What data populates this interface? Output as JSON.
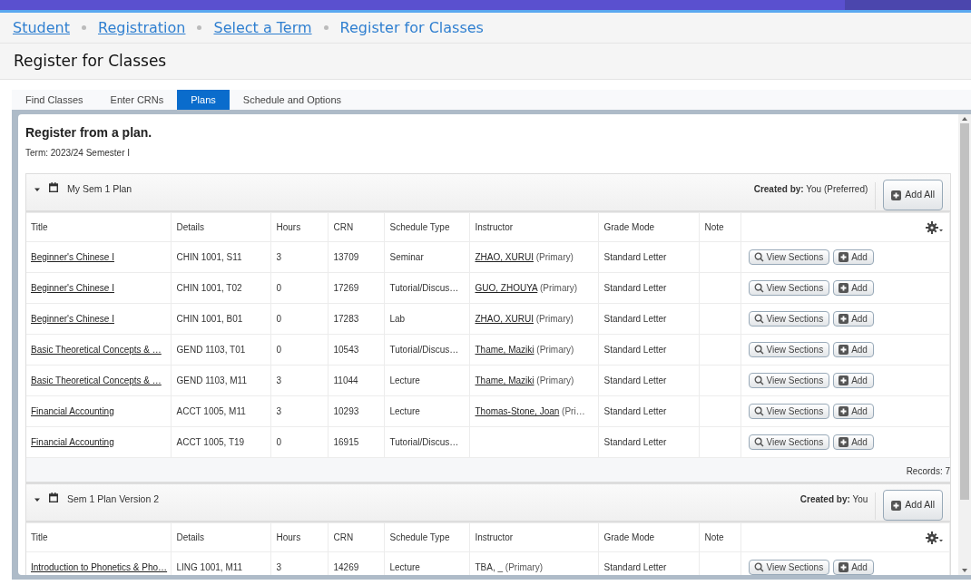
{
  "breadcrumbs": [
    {
      "label": "Student",
      "current": false
    },
    {
      "label": "Registration",
      "current": false
    },
    {
      "label": "Select a Term",
      "current": false
    },
    {
      "label": "Register for Classes",
      "current": true
    }
  ],
  "page_title": "Register for Classes",
  "tabs": [
    {
      "label": "Find Classes",
      "selected": false
    },
    {
      "label": "Enter CRNs",
      "selected": false
    },
    {
      "label": "Plans",
      "selected": true
    },
    {
      "label": "Schedule and Options",
      "selected": false
    }
  ],
  "panel": {
    "heading": "Register from a plan.",
    "term": "Term: 2023/24 Semester I"
  },
  "plans": [
    {
      "name": "My Sem 1 Plan",
      "expanded": true,
      "created_by": "**Created by:** You (Preferred)",
      "add_all": "Add All",
      "records": "Records: 7",
      "columns": [
        "Title",
        "Details",
        "Hours",
        "CRN",
        "Schedule Type",
        "Instructor",
        "Grade Mode",
        "Note"
      ],
      "rows": [
        {
          "title": "Beginner's Chinese I",
          "details": "CHIN 1001, S11",
          "hours": "3",
          "crn": "13709",
          "schedule_type": "Seminar",
          "instructor": {
            "name": "ZHAO, XURUI",
            "link": true,
            "role": "(Primary)"
          },
          "grade_mode": "Standard Letter",
          "view": "View Sections",
          "add": "Add"
        },
        {
          "title": "Beginner's Chinese I",
          "details": "CHIN 1001, T02",
          "hours": "0",
          "crn": "17269",
          "schedule_type": "Tutorial/Discus…",
          "instructor": {
            "name": "GUO, ZHOUYA",
            "link": true,
            "role": "(Primary)"
          },
          "grade_mode": "Standard Letter",
          "view": "View Sections",
          "add": "Add"
        },
        {
          "title": "Beginner's Chinese I",
          "details": "CHIN 1001, B01",
          "hours": "0",
          "crn": "17283",
          "schedule_type": "Lab",
          "instructor": {
            "name": "ZHAO, XURUI",
            "link": true,
            "role": "(Primary)"
          },
          "grade_mode": "Standard Letter",
          "view": "View Sections",
          "add": "Add"
        },
        {
          "title": "Basic Theoretical Concepts & …",
          "details": "GEND 1103, T01",
          "hours": "0",
          "crn": "10543",
          "schedule_type": "Tutorial/Discus…",
          "instructor": {
            "name": "Thame, Maziki",
            "link": true,
            "role": "(Primary)"
          },
          "grade_mode": "Standard Letter",
          "view": "View Sections",
          "add": "Add"
        },
        {
          "title": "Basic Theoretical Concepts & …",
          "details": "GEND 1103, M11",
          "hours": "3",
          "crn": "11044",
          "schedule_type": "Lecture",
          "instructor": {
            "name": "Thame, Maziki",
            "link": true,
            "role": "(Primary)"
          },
          "grade_mode": "Standard Letter",
          "view": "View Sections",
          "add": "Add"
        },
        {
          "title": "Financial Accounting",
          "details": "ACCT 1005, M11",
          "hours": "3",
          "crn": "10293",
          "schedule_type": "Lecture",
          "instructor": {
            "name": "Thomas-Stone, Joan",
            "link": true,
            "role": "(Pri…"
          },
          "grade_mode": "Standard Letter",
          "view": "View Sections",
          "add": "Add"
        },
        {
          "title": "Financial Accounting",
          "details": "ACCT 1005, T19",
          "hours": "0",
          "crn": "16915",
          "schedule_type": "Tutorial/Discus…",
          "grade_mode": "Standard Letter",
          "view": "View Sections",
          "add": "Add"
        }
      ]
    },
    {
      "name": "Sem 1 Plan Version 2",
      "expanded": true,
      "created_by": "**Created by:** You",
      "add_all": "Add All",
      "columns": [
        "Title",
        "Details",
        "Hours",
        "CRN",
        "Schedule Type",
        "Instructor",
        "Grade Mode",
        "Note"
      ],
      "rows": [
        {
          "title": "Introduction to Phonetics & Pho…",
          "details": "LING 1001, M11",
          "hours": "3",
          "crn": "14269",
          "schedule_type": "Lecture",
          "instructor": {
            "name": "TBA, _",
            "link": false,
            "role": "(Primary)"
          },
          "grade_mode": "Standard Letter",
          "view": "View Sections",
          "add": "Add"
        }
      ]
    }
  ]
}
